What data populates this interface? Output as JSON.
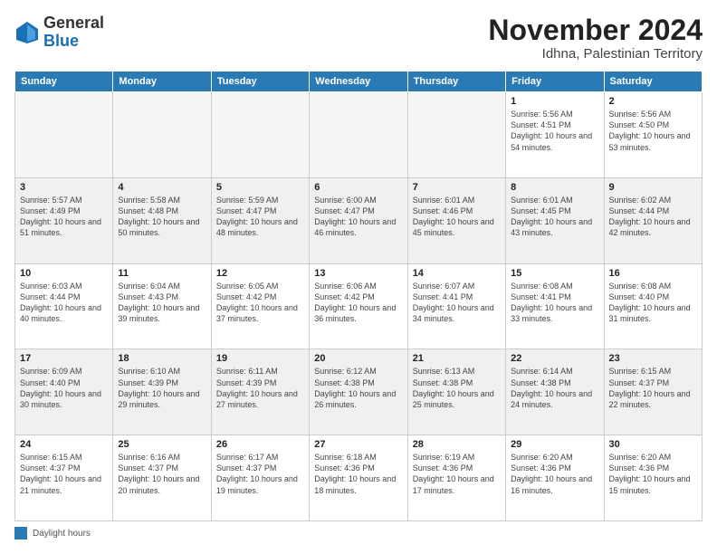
{
  "logo": {
    "general": "General",
    "blue": "Blue"
  },
  "header": {
    "month": "November 2024",
    "location": "Idhna, Palestinian Territory"
  },
  "days_of_week": [
    "Sunday",
    "Monday",
    "Tuesday",
    "Wednesday",
    "Thursday",
    "Friday",
    "Saturday"
  ],
  "weeks": [
    [
      {
        "day": "",
        "info": "",
        "empty": true
      },
      {
        "day": "",
        "info": "",
        "empty": true
      },
      {
        "day": "",
        "info": "",
        "empty": true
      },
      {
        "day": "",
        "info": "",
        "empty": true
      },
      {
        "day": "",
        "info": "",
        "empty": true
      },
      {
        "day": "1",
        "info": "Sunrise: 5:56 AM\nSunset: 4:51 PM\nDaylight: 10 hours\nand 54 minutes."
      },
      {
        "day": "2",
        "info": "Sunrise: 5:56 AM\nSunset: 4:50 PM\nDaylight: 10 hours\nand 53 minutes."
      }
    ],
    [
      {
        "day": "3",
        "info": "Sunrise: 5:57 AM\nSunset: 4:49 PM\nDaylight: 10 hours\nand 51 minutes."
      },
      {
        "day": "4",
        "info": "Sunrise: 5:58 AM\nSunset: 4:48 PM\nDaylight: 10 hours\nand 50 minutes."
      },
      {
        "day": "5",
        "info": "Sunrise: 5:59 AM\nSunset: 4:47 PM\nDaylight: 10 hours\nand 48 minutes."
      },
      {
        "day": "6",
        "info": "Sunrise: 6:00 AM\nSunset: 4:47 PM\nDaylight: 10 hours\nand 46 minutes."
      },
      {
        "day": "7",
        "info": "Sunrise: 6:01 AM\nSunset: 4:46 PM\nDaylight: 10 hours\nand 45 minutes."
      },
      {
        "day": "8",
        "info": "Sunrise: 6:01 AM\nSunset: 4:45 PM\nDaylight: 10 hours\nand 43 minutes."
      },
      {
        "day": "9",
        "info": "Sunrise: 6:02 AM\nSunset: 4:44 PM\nDaylight: 10 hours\nand 42 minutes."
      }
    ],
    [
      {
        "day": "10",
        "info": "Sunrise: 6:03 AM\nSunset: 4:44 PM\nDaylight: 10 hours\nand 40 minutes."
      },
      {
        "day": "11",
        "info": "Sunrise: 6:04 AM\nSunset: 4:43 PM\nDaylight: 10 hours\nand 39 minutes."
      },
      {
        "day": "12",
        "info": "Sunrise: 6:05 AM\nSunset: 4:42 PM\nDaylight: 10 hours\nand 37 minutes."
      },
      {
        "day": "13",
        "info": "Sunrise: 6:06 AM\nSunset: 4:42 PM\nDaylight: 10 hours\nand 36 minutes."
      },
      {
        "day": "14",
        "info": "Sunrise: 6:07 AM\nSunset: 4:41 PM\nDaylight: 10 hours\nand 34 minutes."
      },
      {
        "day": "15",
        "info": "Sunrise: 6:08 AM\nSunset: 4:41 PM\nDaylight: 10 hours\nand 33 minutes."
      },
      {
        "day": "16",
        "info": "Sunrise: 6:08 AM\nSunset: 4:40 PM\nDaylight: 10 hours\nand 31 minutes."
      }
    ],
    [
      {
        "day": "17",
        "info": "Sunrise: 6:09 AM\nSunset: 4:40 PM\nDaylight: 10 hours\nand 30 minutes."
      },
      {
        "day": "18",
        "info": "Sunrise: 6:10 AM\nSunset: 4:39 PM\nDaylight: 10 hours\nand 29 minutes."
      },
      {
        "day": "19",
        "info": "Sunrise: 6:11 AM\nSunset: 4:39 PM\nDaylight: 10 hours\nand 27 minutes."
      },
      {
        "day": "20",
        "info": "Sunrise: 6:12 AM\nSunset: 4:38 PM\nDaylight: 10 hours\nand 26 minutes."
      },
      {
        "day": "21",
        "info": "Sunrise: 6:13 AM\nSunset: 4:38 PM\nDaylight: 10 hours\nand 25 minutes."
      },
      {
        "day": "22",
        "info": "Sunrise: 6:14 AM\nSunset: 4:38 PM\nDaylight: 10 hours\nand 24 minutes."
      },
      {
        "day": "23",
        "info": "Sunrise: 6:15 AM\nSunset: 4:37 PM\nDaylight: 10 hours\nand 22 minutes."
      }
    ],
    [
      {
        "day": "24",
        "info": "Sunrise: 6:15 AM\nSunset: 4:37 PM\nDaylight: 10 hours\nand 21 minutes."
      },
      {
        "day": "25",
        "info": "Sunrise: 6:16 AM\nSunset: 4:37 PM\nDaylight: 10 hours\nand 20 minutes."
      },
      {
        "day": "26",
        "info": "Sunrise: 6:17 AM\nSunset: 4:37 PM\nDaylight: 10 hours\nand 19 minutes."
      },
      {
        "day": "27",
        "info": "Sunrise: 6:18 AM\nSunset: 4:36 PM\nDaylight: 10 hours\nand 18 minutes."
      },
      {
        "day": "28",
        "info": "Sunrise: 6:19 AM\nSunset: 4:36 PM\nDaylight: 10 hours\nand 17 minutes."
      },
      {
        "day": "29",
        "info": "Sunrise: 6:20 AM\nSunset: 4:36 PM\nDaylight: 10 hours\nand 16 minutes."
      },
      {
        "day": "30",
        "info": "Sunrise: 6:20 AM\nSunset: 4:36 PM\nDaylight: 10 hours\nand 15 minutes."
      }
    ]
  ],
  "footer": {
    "legend_label": "Daylight hours"
  }
}
